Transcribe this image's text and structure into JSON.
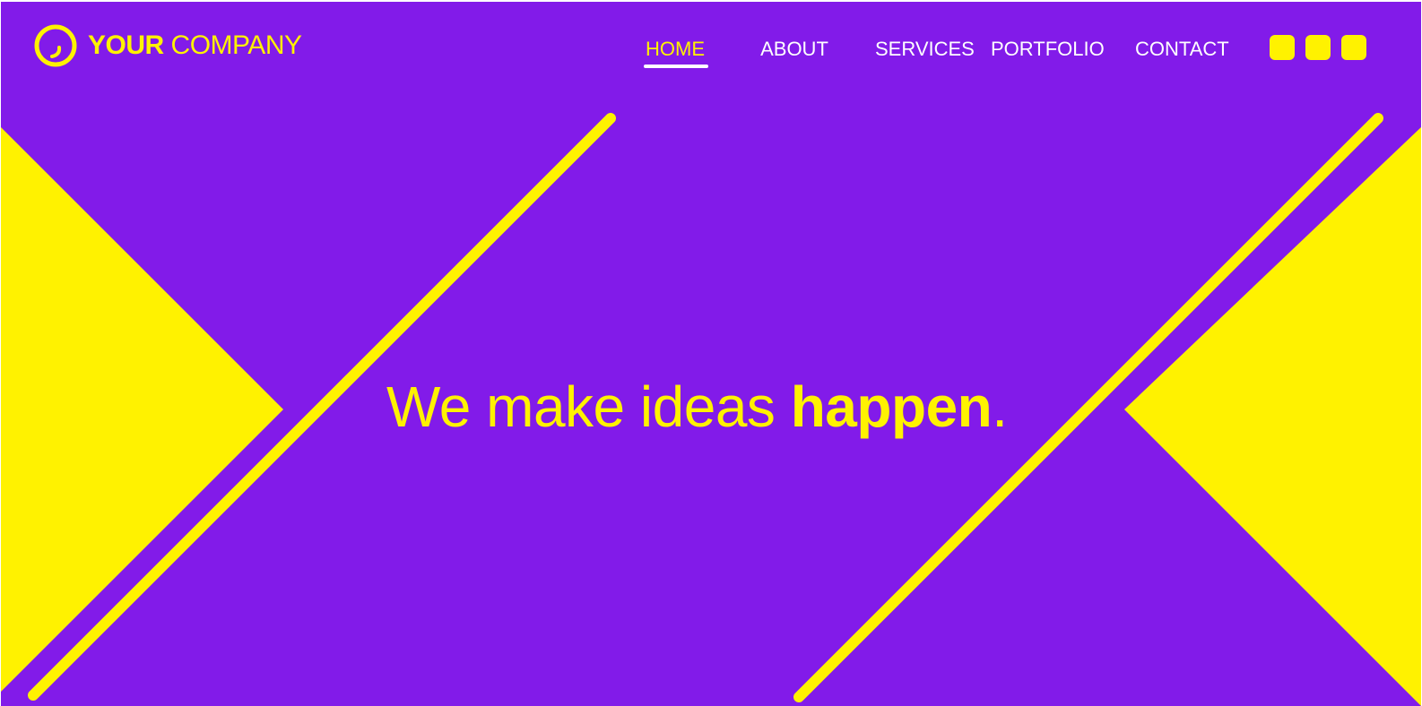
{
  "colors": {
    "background": "#821be9",
    "accent": "#fff200",
    "nav_text": "#ffffff"
  },
  "brand": {
    "logo_icon": "circle-smile-logo",
    "name_bold": "YOUR",
    "name_light": "COMPANY"
  },
  "nav": {
    "active_item": "HOME",
    "items": [
      {
        "label": "HOME"
      },
      {
        "label": "ABOUT"
      },
      {
        "label": "SERVICES"
      },
      {
        "label": "PORTFOLIO"
      },
      {
        "label": "CONTACT"
      }
    ]
  },
  "social": {
    "icons": [
      "social-icon-1",
      "social-icon-2",
      "social-icon-3"
    ]
  },
  "hero": {
    "tagline_light": "We make ideas ",
    "tagline_bold": "happen",
    "tagline_end": "."
  }
}
